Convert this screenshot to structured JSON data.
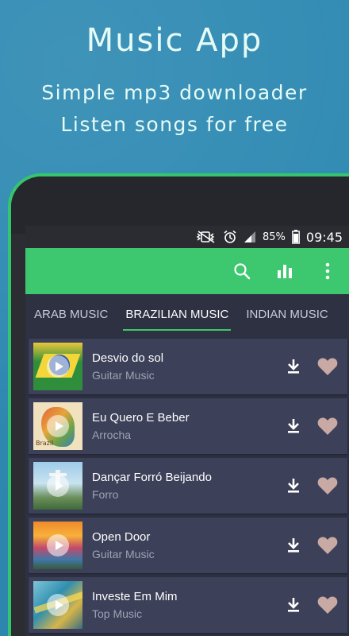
{
  "promo": {
    "title": "Music App",
    "subtitle_line1": "Simple mp3 downloader",
    "subtitle_line2": "Listen songs for free"
  },
  "status_bar": {
    "battery_percent": "85%",
    "time": "09:45",
    "icons": [
      "mute-vibrate-icon",
      "alarm-icon",
      "signal-icon",
      "battery-icon"
    ]
  },
  "toolbar": {
    "icons": [
      "search-icon",
      "equalizer-icon",
      "more-vert-icon"
    ],
    "background_color": "#3dc76f"
  },
  "tabs": [
    {
      "label": "ARAB MUSIC",
      "active": false
    },
    {
      "label": "BRAZILIAN MUSIC",
      "active": true
    },
    {
      "label": "INDIAN MUSIC",
      "active": false
    }
  ],
  "songs": [
    {
      "title": "Desvio do sol",
      "artist": "Guitar Music",
      "thumb": "brazil-flag"
    },
    {
      "title": "Eu Quero E Beber",
      "artist": "Arrocha",
      "thumb": "brazil-map",
      "thumb_label": "Brazil"
    },
    {
      "title": "Dançar Forró Beijando",
      "artist": "Forro",
      "thumb": "rio-statue"
    },
    {
      "title": "Open Door",
      "artist": "Guitar Music",
      "thumb": "colorful-houses"
    },
    {
      "title": "Investe Em Mim",
      "artist": "Top Music",
      "thumb": "glass-art"
    }
  ],
  "colors": {
    "accent": "#3dc76f",
    "background": "#2f8ab3",
    "list_item": "#3c4058",
    "heart": "#c9a9a3"
  }
}
